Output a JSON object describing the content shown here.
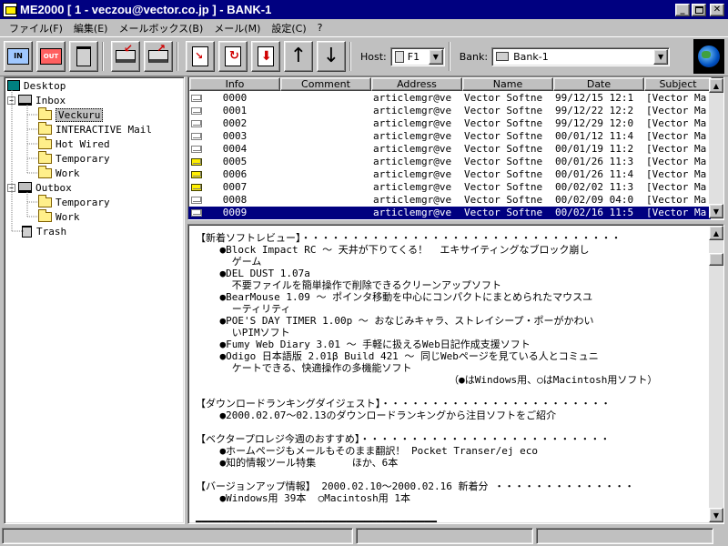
{
  "window": {
    "title": "ME2000 [ 1 - veczou@vector.co.jp ] - BANK-1"
  },
  "menu": [
    "ファイル(F)",
    "編集(E)",
    "メールボックス(B)",
    "メール(M)",
    "設定(C)",
    "?"
  ],
  "toolbar": {
    "buttons": [
      "inbox-in",
      "outbox-out",
      "trash",
      "receive",
      "send",
      "new-mail",
      "reply",
      "forward",
      "move-up",
      "move-down"
    ],
    "in_label": "IN",
    "out_label": "OUT",
    "host_label": "Host:",
    "host_value": "F1",
    "bank_label": "Bank:",
    "bank_value": "Bank-1"
  },
  "tree": [
    {
      "label": "Desktop",
      "level": 0,
      "type": "desktop"
    },
    {
      "label": "Inbox",
      "level": 1,
      "type": "computer",
      "expanded": true
    },
    {
      "label": "Veckuru",
      "level": 2,
      "type": "folder",
      "selected": true
    },
    {
      "label": "INTERACTIVE Mail",
      "level": 2,
      "type": "folder"
    },
    {
      "label": "Hot Wired",
      "level": 2,
      "type": "folder"
    },
    {
      "label": "Temporary",
      "level": 2,
      "type": "folder"
    },
    {
      "label": "Work",
      "level": 2,
      "type": "folder"
    },
    {
      "label": "Outbox",
      "level": 1,
      "type": "computer",
      "expanded": true
    },
    {
      "label": "Temporary",
      "level": 2,
      "type": "folder"
    },
    {
      "label": "Work",
      "level": 2,
      "type": "folder"
    },
    {
      "label": "Trash",
      "level": 1,
      "type": "trash"
    }
  ],
  "list": {
    "columns": [
      "Info",
      "Comment",
      "Address",
      "Name",
      "Date",
      "Subject"
    ],
    "rows": [
      {
        "info": "0000",
        "comment": "",
        "address": "articlemgr@ve",
        "name": "Vector Softne",
        "date": "99/12/15 12:1",
        "subject": "[Vector Ma",
        "unread": false
      },
      {
        "info": "0001",
        "comment": "",
        "address": "articlemgr@ve",
        "name": "Vector Softne",
        "date": "99/12/22 12:2",
        "subject": "[Vector Ma",
        "unread": false
      },
      {
        "info": "0002",
        "comment": "",
        "address": "articlemgr@ve",
        "name": "Vector Softne",
        "date": "99/12/29 12:0",
        "subject": "[Vector Ma",
        "unread": false
      },
      {
        "info": "0003",
        "comment": "",
        "address": "articlemgr@ve",
        "name": "Vector Softne",
        "date": "00/01/12 11:4",
        "subject": "[Vector Ma",
        "unread": false
      },
      {
        "info": "0004",
        "comment": "",
        "address": "articlemgr@ve",
        "name": "Vector Softne",
        "date": "00/01/19 11:2",
        "subject": "[Vector Ma",
        "unread": false
      },
      {
        "info": "0005",
        "comment": "",
        "address": "articlemgr@ve",
        "name": "Vector Softne",
        "date": "00/01/26 11:3",
        "subject": "[Vector Ma",
        "unread": true
      },
      {
        "info": "0006",
        "comment": "",
        "address": "articlemgr@ve",
        "name": "Vector Softne",
        "date": "00/01/26 11:4",
        "subject": "[Vector Ma",
        "unread": true
      },
      {
        "info": "0007",
        "comment": "",
        "address": "articlemgr@ve",
        "name": "Vector Softne",
        "date": "00/02/02 11:3",
        "subject": "[Vector Ma",
        "unread": true
      },
      {
        "info": "0008",
        "comment": "",
        "address": "articlemgr@ve",
        "name": "Vector Softne",
        "date": "00/02/09 04:0",
        "subject": "[Vector Ma",
        "unread": false
      },
      {
        "info": "0009",
        "comment": "",
        "address": "articlemgr@ve",
        "name": "Vector Softne",
        "date": "00/02/16 11:5",
        "subject": "[Vector Ma",
        "unread": false,
        "selected": true
      }
    ]
  },
  "body_lines": [
    "【新着ソフトレビュー】・・・・・・・・・・・・・・・・・・・・・・・・・・・・・・・・",
    "    ●Block Impact RC 〜 天井が下りてくる！  エキサイティングなブロック崩し",
    "      ゲーム",
    "    ●DEL DUST 1.07a",
    "      不要ファイルを簡単操作で削除できるクリーンアップソフト",
    "    ●BearMouse 1.09 〜 ポインタ移動を中心にコンパクトにまとめられたマウスユ",
    "      ーティリティ",
    "    ●POE'S DAY TIMER 1.00p 〜 おなじみキャラ、ストレイシープ・ポーがかわい",
    "      いPIMソフト",
    "    ●Fumy Web Diary 3.01 〜 手軽に扱えるWeb日記作成支援ソフト",
    "    ●Odigo 日本語版 2.01β Build 421 〜 同じWebページを見ている人とコミュニ",
    "      ケートできる、快適操作の多機能ソフト",
    "                                          （●はWindows用、○はMacintosh用ソフト）",
    "",
    "【ダウンロードランキングダイジェスト】・・・・・・・・・・・・・・・・・・・・・・・",
    "    ●2000.02.07〜02.13のダウンロードランキングから注目ソフトをご紹介",
    "",
    "【ベクタープロレジ今週のおすすめ】・・・・・・・・・・・・・・・・・・・・・・・・・",
    "    ●ホームページもメールもそのまま翻訳！ Pocket Transer/ej eco",
    "    ●知的情報ツール特集      ほか、6本",
    "",
    "【バージョンアップ情報】 2000.02.10〜2000.02.16 新着分 ・・・・・・・・・・・・・・",
    "    ●Windows用 39本  ○Macintosh用 1本",
    "",
    "━━━━━━━━━━━━━━━━━━━━━━━━━━━━━━━━━━━━━━━━"
  ]
}
